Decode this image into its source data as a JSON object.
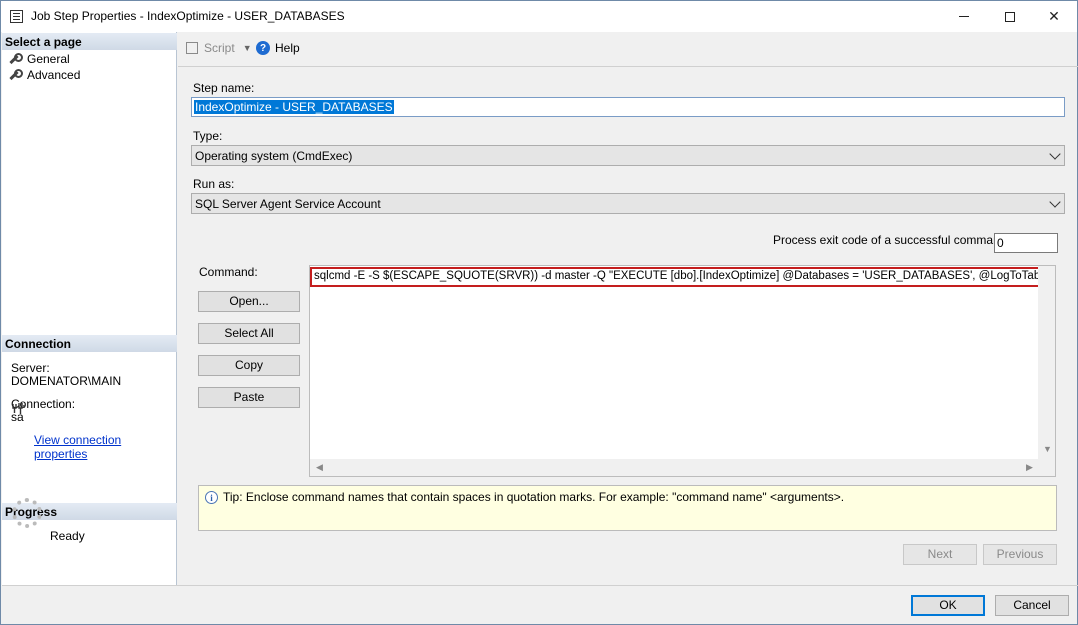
{
  "window": {
    "title": "Job Step Properties - IndexOptimize - USER_DATABASES"
  },
  "left": {
    "select_page_header": "Select a page",
    "pages": [
      "General",
      "Advanced"
    ],
    "connection_header": "Connection",
    "server_label": "Server:",
    "server_value": "DOMENATOR\\MAIN",
    "connection_label": "Connection:",
    "connection_value": "sa",
    "view_connection_link": "View connection properties",
    "progress_header": "Progress",
    "progress_status": "Ready"
  },
  "toolbar": {
    "script_label": "Script",
    "help_label": "Help"
  },
  "form": {
    "step_name_label": "Step name:",
    "step_name_value": "IndexOptimize - USER_DATABASES",
    "type_label": "Type:",
    "type_value": "Operating system (CmdExec)",
    "run_as_label": "Run as:",
    "run_as_value": "SQL Server Agent Service Account",
    "exit_code_label": "Process exit code of a successful command:",
    "exit_code_value": "0",
    "command_label": "Command:",
    "command_value": "sqlcmd -E -S $(ESCAPE_SQUOTE(SRVR)) -d master -Q \"EXECUTE [dbo].[IndexOptimize] @Databases = 'USER_DATABASES', @LogToTable = 'Y'\" -b",
    "buttons": {
      "open": "Open...",
      "select_all": "Select All",
      "copy": "Copy",
      "paste": "Paste"
    },
    "tip": "Tip: Enclose command names that contain spaces in quotation marks. For example: \"command name\" <arguments>.",
    "next": "Next",
    "previous": "Previous"
  },
  "footer": {
    "ok": "OK",
    "cancel": "Cancel"
  },
  "colors": {
    "accent": "#0078d7",
    "highlight_border": "#c41e1e",
    "tip_background": "#ffffe1"
  }
}
